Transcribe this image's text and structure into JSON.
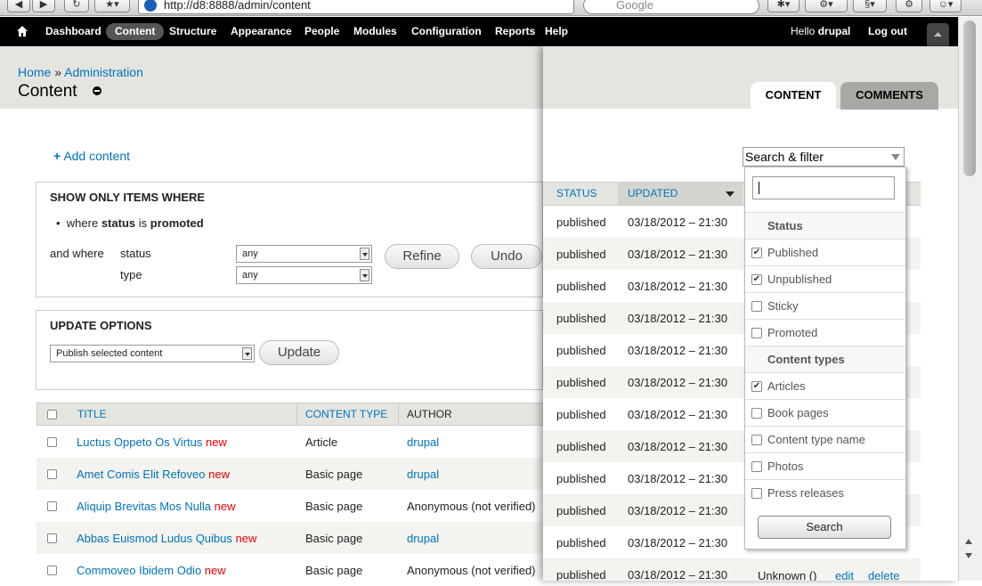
{
  "browser": {
    "url": "http://d8:8888/admin/content",
    "search_placeholder": "Google"
  },
  "toolbar": {
    "items": [
      "Dashboard",
      "Content",
      "Structure",
      "Appearance",
      "People",
      "Modules",
      "Configuration",
      "Reports",
      "Help"
    ],
    "active": "Content",
    "greeting_prefix": "Hello",
    "username": "drupal",
    "logout": "Log out"
  },
  "header": {
    "breadcrumb_home": "Home",
    "breadcrumb_sep": "»",
    "breadcrumb_admin": "Administration",
    "title": "Content"
  },
  "actions": {
    "add_content": "Add content"
  },
  "filter": {
    "legend": "SHOW ONLY ITEMS WHERE",
    "current_where": "where",
    "current_field": "status",
    "current_is": "is",
    "current_value": "promoted",
    "and_where": "and where",
    "status_label": "status",
    "status_value": "any",
    "type_label": "type",
    "type_value": "any",
    "refine": "Refine",
    "undo": "Undo"
  },
  "update": {
    "legend": "UPDATE OPTIONS",
    "operation": "Publish selected content",
    "button": "Update"
  },
  "table": {
    "headers": {
      "title": "TITLE",
      "content_type": "CONTENT TYPE",
      "author": "AUTHOR",
      "status": "STATUS",
      "updated": "UPDATED"
    },
    "new_marker": "new",
    "rows": [
      {
        "title": "Luctus Oppeto Os Virtus",
        "type": "Article",
        "author": "drupal"
      },
      {
        "title": "Amet Comis Elit Refoveo",
        "type": "Basic page",
        "author": "drupal"
      },
      {
        "title": "Aliquip Brevitas Mos Nulla",
        "type": "Basic page",
        "author": "Anonymous (not verified)"
      },
      {
        "title": "Abbas Euismod Ludus Quibus",
        "type": "Basic page",
        "author": "drupal"
      },
      {
        "title": "Commoveo Ibidem Odio",
        "type": "Basic page",
        "author": "Anonymous (not verified)"
      }
    ],
    "status_rows": [
      {
        "status": "published",
        "updated": "03/18/2012 – 21:30"
      },
      {
        "status": "published",
        "updated": "03/18/2012 – 21:30"
      },
      {
        "status": "published",
        "updated": "03/18/2012 – 21:30"
      },
      {
        "status": "published",
        "updated": "03/18/2012 – 21:30"
      },
      {
        "status": "published",
        "updated": "03/18/2012 – 21:30"
      },
      {
        "status": "published",
        "updated": "03/18/2012 – 21:30"
      },
      {
        "status": "published",
        "updated": "03/18/2012 – 21:30"
      },
      {
        "status": "published",
        "updated": "03/18/2012 – 21:30"
      },
      {
        "status": "published",
        "updated": "03/18/2012 – 21:30"
      },
      {
        "status": "published",
        "updated": "03/18/2012 – 21:30"
      },
      {
        "status": "published",
        "updated": "03/18/2012 – 21:30"
      },
      {
        "status": "published",
        "updated": "03/18/2012 – 21:30"
      }
    ],
    "last_row_extra": {
      "author": "Unknown ()",
      "edit": "edit",
      "delete": "delete"
    }
  },
  "overlay": {
    "tabs": [
      "CONTENT",
      "COMMENTS"
    ],
    "active_tab": "CONTENT"
  },
  "search_filter": {
    "label": "Search & filter",
    "input_value": "",
    "groups": [
      {
        "title": "Status",
        "options": [
          {
            "label": "Published",
            "checked": true
          },
          {
            "label": "Unpublished",
            "checked": true
          },
          {
            "label": "Sticky",
            "checked": false
          },
          {
            "label": "Promoted",
            "checked": false
          }
        ]
      },
      {
        "title": "Content types",
        "options": [
          {
            "label": "Articles",
            "checked": true
          },
          {
            "label": "Book pages",
            "checked": false
          },
          {
            "label": "Content type name",
            "checked": false
          },
          {
            "label": "Photos",
            "checked": false
          },
          {
            "label": "Press releases",
            "checked": false
          }
        ]
      }
    ],
    "search_button": "Search"
  }
}
